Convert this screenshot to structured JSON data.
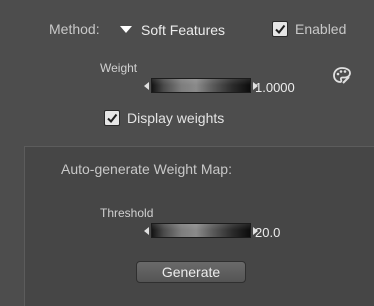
{
  "method": {
    "label": "Method:",
    "selected": "Soft Features",
    "dropdown_icon": "triangle-down-icon"
  },
  "enabled": {
    "label": "Enabled",
    "checked": true
  },
  "weight": {
    "label": "Weight",
    "value": "1.0000",
    "reset_icon": "paint-palette-icon"
  },
  "display_weights": {
    "label": "Display weights",
    "checked": true
  },
  "auto_generate": {
    "title": "Auto-generate Weight Map:",
    "threshold_label": "Threshold",
    "threshold_value": "20.0",
    "generate_label": "Generate"
  }
}
